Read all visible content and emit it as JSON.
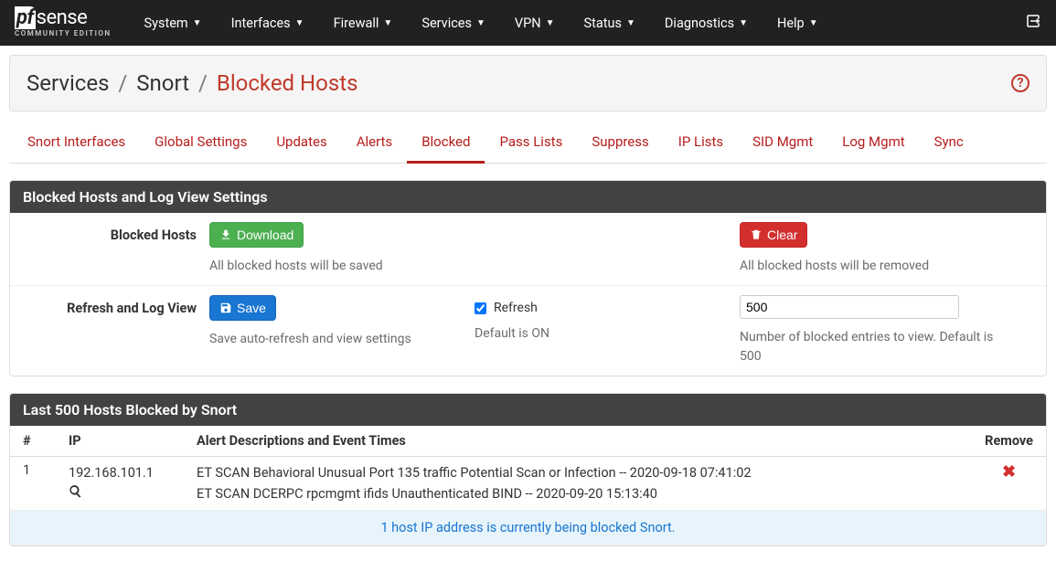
{
  "brand": {
    "logo_box": "pf",
    "logo_text": "sense",
    "subtitle": "COMMUNITY EDITION"
  },
  "nav": {
    "items": [
      {
        "label": "System"
      },
      {
        "label": "Interfaces"
      },
      {
        "label": "Firewall"
      },
      {
        "label": "Services"
      },
      {
        "label": "VPN"
      },
      {
        "label": "Status"
      },
      {
        "label": "Diagnostics"
      },
      {
        "label": "Help"
      }
    ]
  },
  "breadcrumb": {
    "a": "Services",
    "b": "Snort",
    "c": "Blocked Hosts",
    "sep": "/"
  },
  "tabs": [
    {
      "label": "Snort Interfaces"
    },
    {
      "label": "Global Settings"
    },
    {
      "label": "Updates"
    },
    {
      "label": "Alerts"
    },
    {
      "label": "Blocked"
    },
    {
      "label": "Pass Lists"
    },
    {
      "label": "Suppress"
    },
    {
      "label": "IP Lists"
    },
    {
      "label": "SID Mgmt"
    },
    {
      "label": "Log Mgmt"
    },
    {
      "label": "Sync"
    }
  ],
  "active_tab": 4,
  "panels": {
    "settings": {
      "title": "Blocked Hosts and Log View Settings",
      "row1": {
        "label": "Blocked Hosts",
        "download_btn": "Download",
        "download_help": "All blocked hosts will be saved",
        "clear_btn": "Clear",
        "clear_help": "All blocked hosts will be removed"
      },
      "row2": {
        "label": "Refresh and Log View",
        "save_btn": "Save",
        "save_help": "Save auto-refresh and view settings",
        "refresh_label": "Refresh",
        "refresh_checked": true,
        "refresh_help": "Default is ON",
        "entries_value": "500",
        "entries_help": "Number of blocked entries to view. Default is 500"
      }
    },
    "blocked": {
      "title": "Last 500 Hosts Blocked by Snort",
      "columns": {
        "num": "#",
        "ip": "IP",
        "desc": "Alert Descriptions and Event Times",
        "remove": "Remove"
      },
      "rows": [
        {
          "num": "1",
          "ip": "192.168.101.1",
          "alerts": [
            "ET SCAN Behavioral Unusual Port 135 traffic Potential Scan or Infection -- 2020-09-18 07:41:02",
            "ET SCAN DCERPC rpcmgmt ifids Unauthenticated BIND -- 2020-09-20 15:13:40"
          ]
        }
      ],
      "status": "1 host IP address is currently being blocked Snort."
    }
  }
}
